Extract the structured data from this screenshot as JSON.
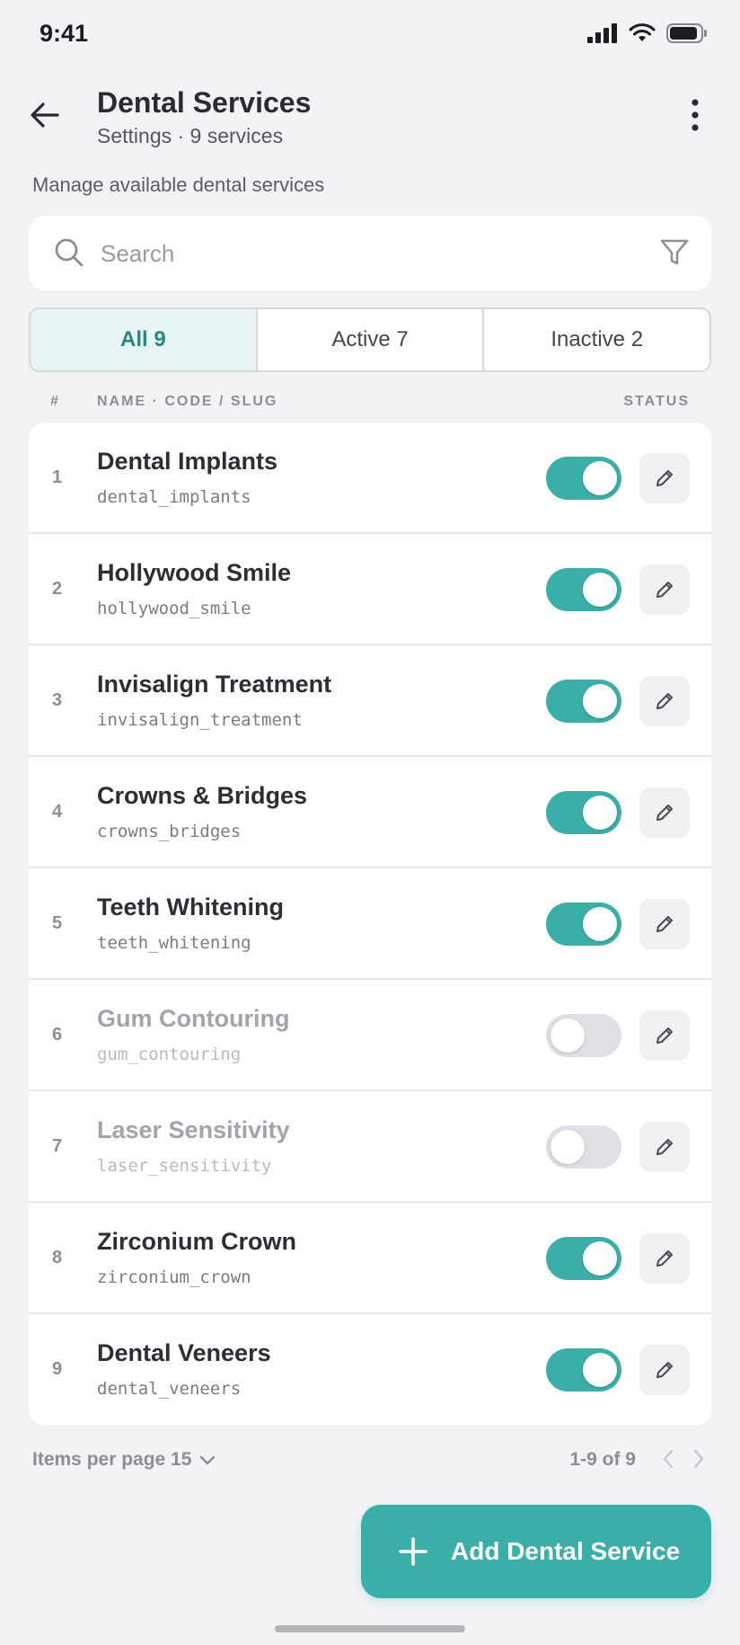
{
  "status_bar": {
    "time": "9:41"
  },
  "header": {
    "title": "Dental Services",
    "subtitle": "Settings · 9 services"
  },
  "description": "Manage available dental services",
  "search": {
    "placeholder": "Search",
    "value": ""
  },
  "tabs": [
    {
      "label": "All 9",
      "active": true
    },
    {
      "label": "Active 7",
      "active": false
    },
    {
      "label": "Inactive 2",
      "active": false
    }
  ],
  "columns": {
    "number": "#",
    "name": "NAME · CODE / SLUG",
    "status": "STATUS"
  },
  "services": [
    {
      "num": "1",
      "name": "Dental Implants",
      "slug": "dental_implants",
      "active": true
    },
    {
      "num": "2",
      "name": "Hollywood Smile",
      "slug": "hollywood_smile",
      "active": true
    },
    {
      "num": "3",
      "name": "Invisalign Treatment",
      "slug": "invisalign_treatment",
      "active": true
    },
    {
      "num": "4",
      "name": "Crowns & Bridges",
      "slug": "crowns_bridges",
      "active": true
    },
    {
      "num": "5",
      "name": "Teeth Whitening",
      "slug": "teeth_whitening",
      "active": true
    },
    {
      "num": "6",
      "name": "Gum Contouring",
      "slug": "gum_contouring",
      "active": false
    },
    {
      "num": "7",
      "name": "Laser Sensitivity",
      "slug": "laser_sensitivity",
      "active": false
    },
    {
      "num": "8",
      "name": "Zirconium Crown",
      "slug": "zirconium_crown",
      "active": true
    },
    {
      "num": "9",
      "name": "Dental Veneers",
      "slug": "dental_veneers",
      "active": true
    }
  ],
  "pagination": {
    "per_page_label": "Items per page 15",
    "range": "1-9 of 9"
  },
  "fab": {
    "label": "Add Dental Service"
  },
  "colors": {
    "accent": "#3aafa9",
    "toggle_off": "#dfdfe6",
    "background": "#f3f3f6"
  },
  "icons": {
    "back": "arrow-left-icon",
    "more": "more-vertical-icon",
    "search": "search-icon",
    "filter": "filter-icon",
    "edit": "pencil-icon",
    "add": "plus-icon",
    "chevron": "chevron-down-icon",
    "prev": "chevron-left-icon",
    "next": "chevron-right-icon"
  }
}
